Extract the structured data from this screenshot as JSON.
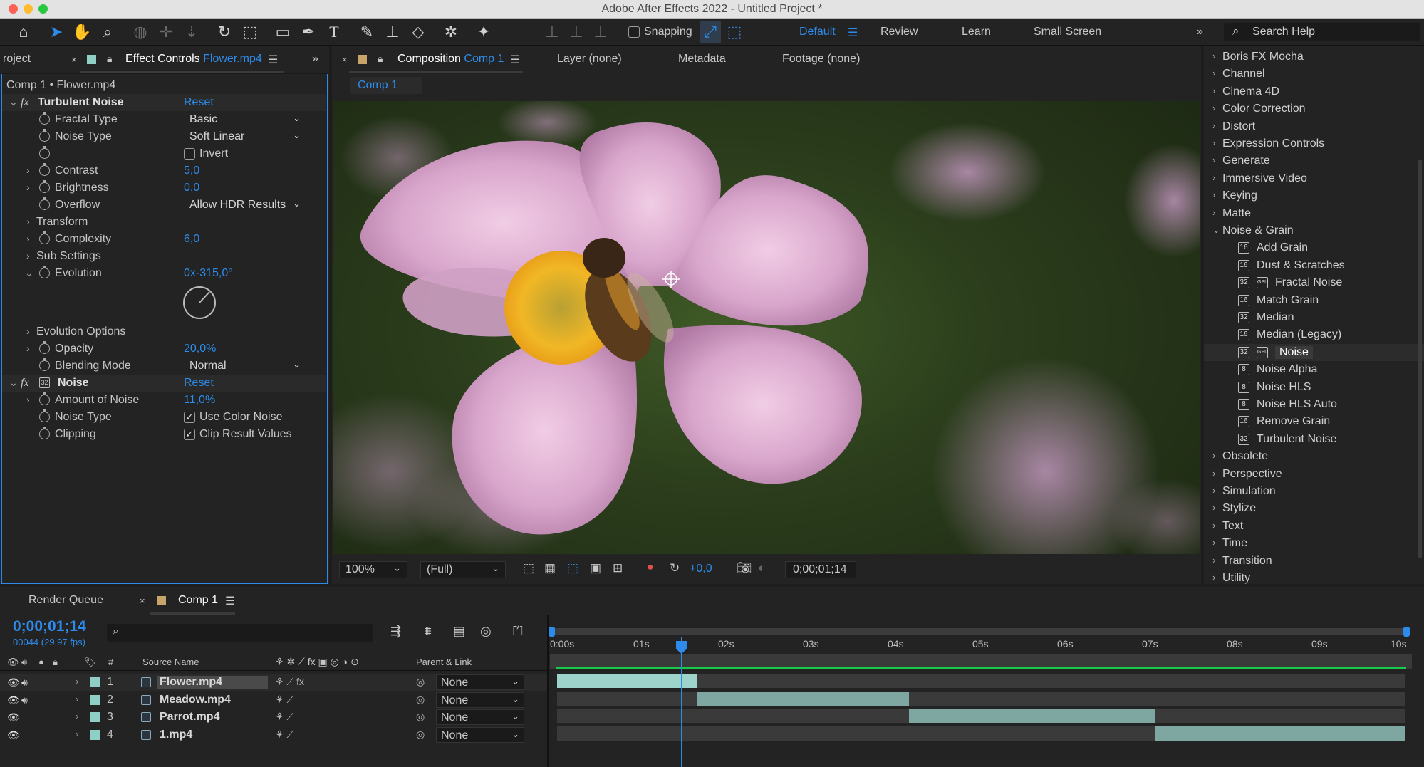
{
  "window": {
    "title": "Adobe After Effects 2022 - Untitled Project *"
  },
  "toolbar": {
    "snapping_label": "Snapping",
    "workspaces": [
      "Default",
      "Review",
      "Learn",
      "Small Screen"
    ],
    "search_label": "Search Help"
  },
  "left_panel": {
    "project_tab": "roject",
    "effect_controls_tab": "Effect Controls",
    "effect_controls_file": "Flower.mp4",
    "header": "Comp 1 • Flower.mp4",
    "turbulent": {
      "name": "Turbulent Noise",
      "reset": "Reset",
      "fractal_type": {
        "label": "Fractal Type",
        "value": "Basic"
      },
      "noise_type": {
        "label": "Noise Type",
        "value": "Soft Linear"
      },
      "invert": {
        "label": "Invert",
        "checked": false
      },
      "contrast": {
        "label": "Contrast",
        "value": "5,0"
      },
      "brightness": {
        "label": "Brightness",
        "value": "0,0"
      },
      "overflow": {
        "label": "Overflow",
        "value": "Allow HDR Results"
      },
      "transform": "Transform",
      "complexity": {
        "label": "Complexity",
        "value": "6,0"
      },
      "sub_settings": "Sub Settings",
      "evolution": {
        "label": "Evolution",
        "value": "0x-315,0°"
      },
      "evolution_options": "Evolution Options",
      "opacity": {
        "label": "Opacity",
        "value": "20,0%"
      },
      "blending": {
        "label": "Blending Mode",
        "value": "Normal"
      }
    },
    "noise": {
      "name": "Noise",
      "reset": "Reset",
      "amount": {
        "label": "Amount of Noise",
        "value": "11,0%"
      },
      "noise_type": {
        "label": "Noise Type",
        "check_label": "Use Color Noise",
        "checked": true
      },
      "clipping": {
        "label": "Clipping",
        "check_label": "Clip Result Values",
        "checked": true
      }
    }
  },
  "viewer": {
    "tabs": {
      "composition": "Composition",
      "comp_name": "Comp 1",
      "layer": "Layer (none)",
      "metadata": "Metadata",
      "footage": "Footage (none)"
    },
    "comp_chip": "Comp 1",
    "zoom": "100%",
    "resolution": "(Full)",
    "exposure": "+0,0",
    "timecode": "0;00;01;14"
  },
  "effects_panel": {
    "categories_top": [
      "Boris FX Mocha",
      "Channel",
      "Cinema 4D",
      "Color Correction",
      "Distort",
      "Expression Controls",
      "Generate",
      "Immersive Video",
      "Keying",
      "Matte"
    ],
    "open_category": "Noise & Grain",
    "items": [
      {
        "name": "Add Grain",
        "badge": "16"
      },
      {
        "name": "Dust & Scratches",
        "badge": "16"
      },
      {
        "name": "Fractal Noise",
        "badge": "32"
      },
      {
        "name": "Match Grain",
        "badge": "16"
      },
      {
        "name": "Median",
        "badge": "32"
      },
      {
        "name": "Median (Legacy)",
        "badge": "16"
      },
      {
        "name": "Noise",
        "badge": "32"
      },
      {
        "name": "Noise Alpha",
        "badge": "8"
      },
      {
        "name": "Noise HLS",
        "badge": "8"
      },
      {
        "name": "Noise HLS Auto",
        "badge": "8"
      },
      {
        "name": "Remove Grain",
        "badge": "16"
      },
      {
        "name": "Turbulent Noise",
        "badge": "32"
      }
    ],
    "categories_bottom": [
      "Obsolete",
      "Perspective",
      "Simulation",
      "Stylize",
      "Text",
      "Time",
      "Transition",
      "Utility"
    ]
  },
  "timeline": {
    "render_queue_tab": "Render Queue",
    "comp_tab": "Comp 1",
    "timecode": "0;00;01;14",
    "frame_info": "00044 (29.97 fps)",
    "col_hash": "#",
    "col_source": "Source Name",
    "col_parent": "Parent & Link",
    "ruler": [
      "0:00s",
      "01s",
      "02s",
      "03s",
      "04s",
      "05s",
      "06s",
      "07s",
      "08s",
      "09s",
      "10s"
    ],
    "layers": [
      {
        "num": "1",
        "name": "Flower.mp4",
        "parent": "None",
        "start": 0.0,
        "end": 1.65
      },
      {
        "num": "2",
        "name": "Meadow.mp4",
        "parent": "None",
        "start": 1.65,
        "end": 4.15
      },
      {
        "num": "3",
        "name": "Parrot.mp4",
        "parent": "None",
        "start": 4.15,
        "end": 7.05
      },
      {
        "num": "4",
        "name": "1.mp4",
        "parent": "None",
        "start": 7.05,
        "end": 10.0
      }
    ]
  }
}
